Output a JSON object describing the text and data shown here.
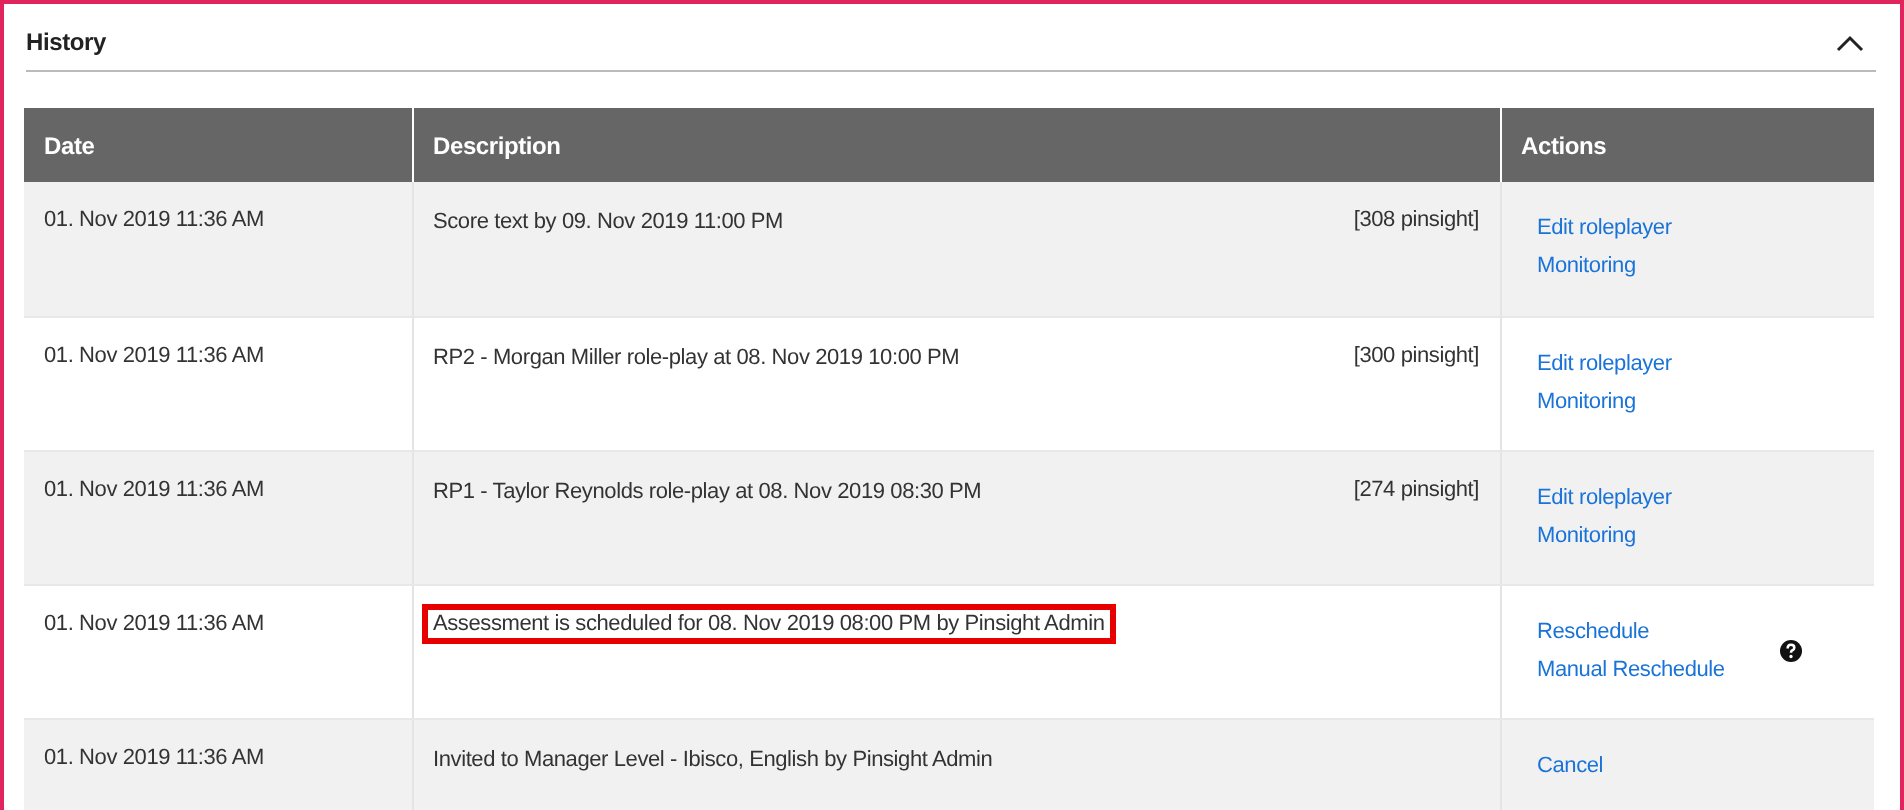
{
  "panel": {
    "title": "History",
    "expanded": true
  },
  "table": {
    "columns": [
      "Date",
      "Description",
      "Actions"
    ],
    "rows": [
      {
        "date": "01. Nov 2019 11:36 AM",
        "description": "Score text by 09. Nov 2019 11:00 PM",
        "tag": "[308 pinsight]",
        "highlighted": false,
        "actions": [
          "Edit roleplayer",
          "Monitoring"
        ],
        "help": false
      },
      {
        "date": "01. Nov 2019 11:36 AM",
        "description": "RP2 - Morgan Miller role-play at 08. Nov 2019 10:00 PM",
        "tag": "[300 pinsight]",
        "highlighted": false,
        "actions": [
          "Edit roleplayer",
          "Monitoring"
        ],
        "help": false
      },
      {
        "date": "01. Nov 2019 11:36 AM",
        "description": "RP1 - Taylor Reynolds role-play at 08. Nov 2019 08:30 PM",
        "tag": "[274 pinsight]",
        "highlighted": false,
        "actions": [
          "Edit roleplayer",
          "Monitoring"
        ],
        "help": false
      },
      {
        "date": "01. Nov 2019 11:36 AM",
        "description": "Assessment is scheduled for 08. Nov 2019 08:00 PM by Pinsight Admin",
        "highlighted": true,
        "actions": [
          "Reschedule",
          "Manual Reschedule"
        ],
        "help": true
      },
      {
        "date": "01. Nov 2019 11:36 AM",
        "description": "Invited to Manager Level - Ibisco, English by Pinsight Admin",
        "highlighted": false,
        "actions": [
          "Cancel"
        ],
        "help": false
      }
    ]
  }
}
